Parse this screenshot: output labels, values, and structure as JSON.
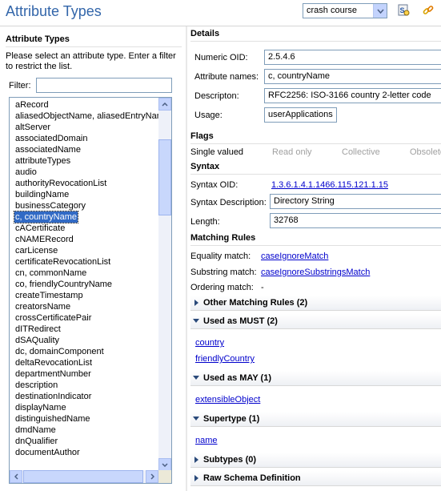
{
  "header": {
    "title": "Attribute Types",
    "connection": "crash course"
  },
  "left": {
    "title": "Attribute Types",
    "description": "Please select an attribute type. Enter a filter to restrict the list.",
    "filter_label": "Filter:",
    "filter_value": "",
    "items": [
      "aRecord",
      "aliasedObjectName, aliasedEntryName",
      "altServer",
      "associatedDomain",
      "associatedName",
      "attributeTypes",
      "audio",
      "authorityRevocationList",
      "buildingName",
      "businessCategory",
      "c, countryName",
      "cACertificate",
      "cNAMERecord",
      "carLicense",
      "certificateRevocationList",
      "cn, commonName",
      "co, friendlyCountryName",
      "createTimestamp",
      "creatorsName",
      "crossCertificatePair",
      "dITRedirect",
      "dSAQuality",
      "dc, domainComponent",
      "deltaRevocationList",
      "departmentNumber",
      "description",
      "destinationIndicator",
      "displayName",
      "distinguishedName",
      "dmdName",
      "dnQualifier",
      "documentAuthor"
    ],
    "selected_index": 10
  },
  "details": {
    "title": "Details",
    "oid_label": "Numeric OID:",
    "oid_value": "2.5.4.6",
    "names_label": "Attribute names:",
    "names_value": "c, countryName",
    "desc_label": "Descripton:",
    "desc_value": "RFC2256: ISO-3166 country 2-letter code",
    "usage_label": "Usage:",
    "usage_value": "userApplications"
  },
  "flags": {
    "title": "Flags",
    "single": "Single valued",
    "readonly": "Read only",
    "collective": "Collective",
    "obsolete": "Obsolete"
  },
  "syntax": {
    "title": "Syntax",
    "oid_label": "Syntax OID:",
    "oid_value": "1.3.6.1.4.1.1466.115.121.1.15",
    "desc_label": "Syntax Description:",
    "desc_value": "Directory String",
    "length_label": "Length:",
    "length_value": "32768"
  },
  "matching": {
    "title": "Matching Rules",
    "equality_label": "Equality match:",
    "equality_value": "caseIgnoreMatch",
    "substring_label": "Substring match:",
    "substring_value": "caseIgnoreSubstringsMatch",
    "ordering_label": "Ordering match:",
    "ordering_value": "-"
  },
  "sections": {
    "other_rules": "Other Matching Rules (2)",
    "must": "Used as MUST (2)",
    "must_items": [
      "country",
      "friendlyCountry"
    ],
    "may": "Used as MAY (1)",
    "may_items": [
      "extensibleObject"
    ],
    "supertype": "Supertype (1)",
    "supertype_items": [
      "name"
    ],
    "subtypes": "Subtypes (0)",
    "raw": "Raw Schema Definition"
  },
  "colors": {
    "title": "#3366aa",
    "link": "#0000cc",
    "selection": "#316ac5"
  }
}
